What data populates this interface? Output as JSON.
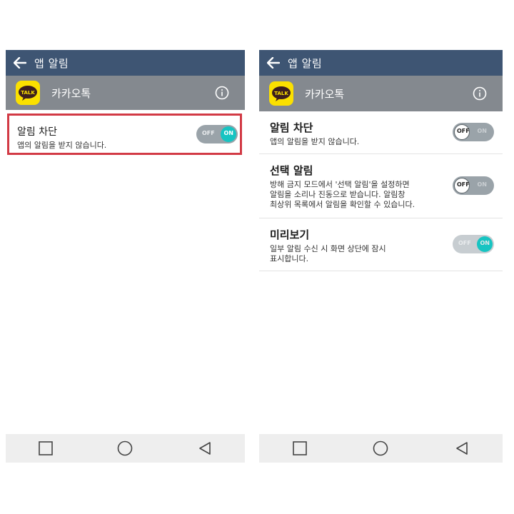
{
  "left": {
    "title": "앱 알림",
    "app_name": "카카오톡",
    "app_icon_text": "TALK",
    "row": {
      "title": "알림 차단",
      "desc": "앱의 알림을 받지 않습니다.",
      "toggle": {
        "off": "OFF",
        "on": "ON",
        "state": "on"
      }
    }
  },
  "right": {
    "title": "앱 알림",
    "app_name": "카카오톡",
    "app_icon_text": "TALK",
    "rows": [
      {
        "title": "알림 차단",
        "desc": [
          "앱의 알림을 받지 않습니다."
        ],
        "toggle": {
          "off": "OFF",
          "on": "ON",
          "state": "off"
        }
      },
      {
        "title": "선택 알림",
        "desc": [
          "방해 금지 모드에서 '선택 알림'을 설정하면",
          "알림을 소리나 진동으로 받습니다. 알림창",
          "최상위 목록에서 알림을 확인할 수 있습니다."
        ],
        "toggle": {
          "off": "OFF",
          "on": "ON",
          "state": "off"
        }
      },
      {
        "title": "미리보기",
        "desc": [
          "일부 알림 수신 시 화면 상단에 잠시",
          "표시합니다."
        ],
        "toggle": {
          "off": "OFF",
          "on": "ON",
          "state": "on"
        }
      }
    ]
  },
  "colors": {
    "titlebar": "#3e5573",
    "appbar": "#84898f",
    "kakao_yellow": "#fbe000",
    "toggle_on": "#17c4c2",
    "highlight": "#d23a45"
  },
  "icons": [
    "back-arrow-icon",
    "kakaotalk-icon",
    "info-icon",
    "recent-apps-icon",
    "home-icon",
    "back-triangle-icon"
  ]
}
